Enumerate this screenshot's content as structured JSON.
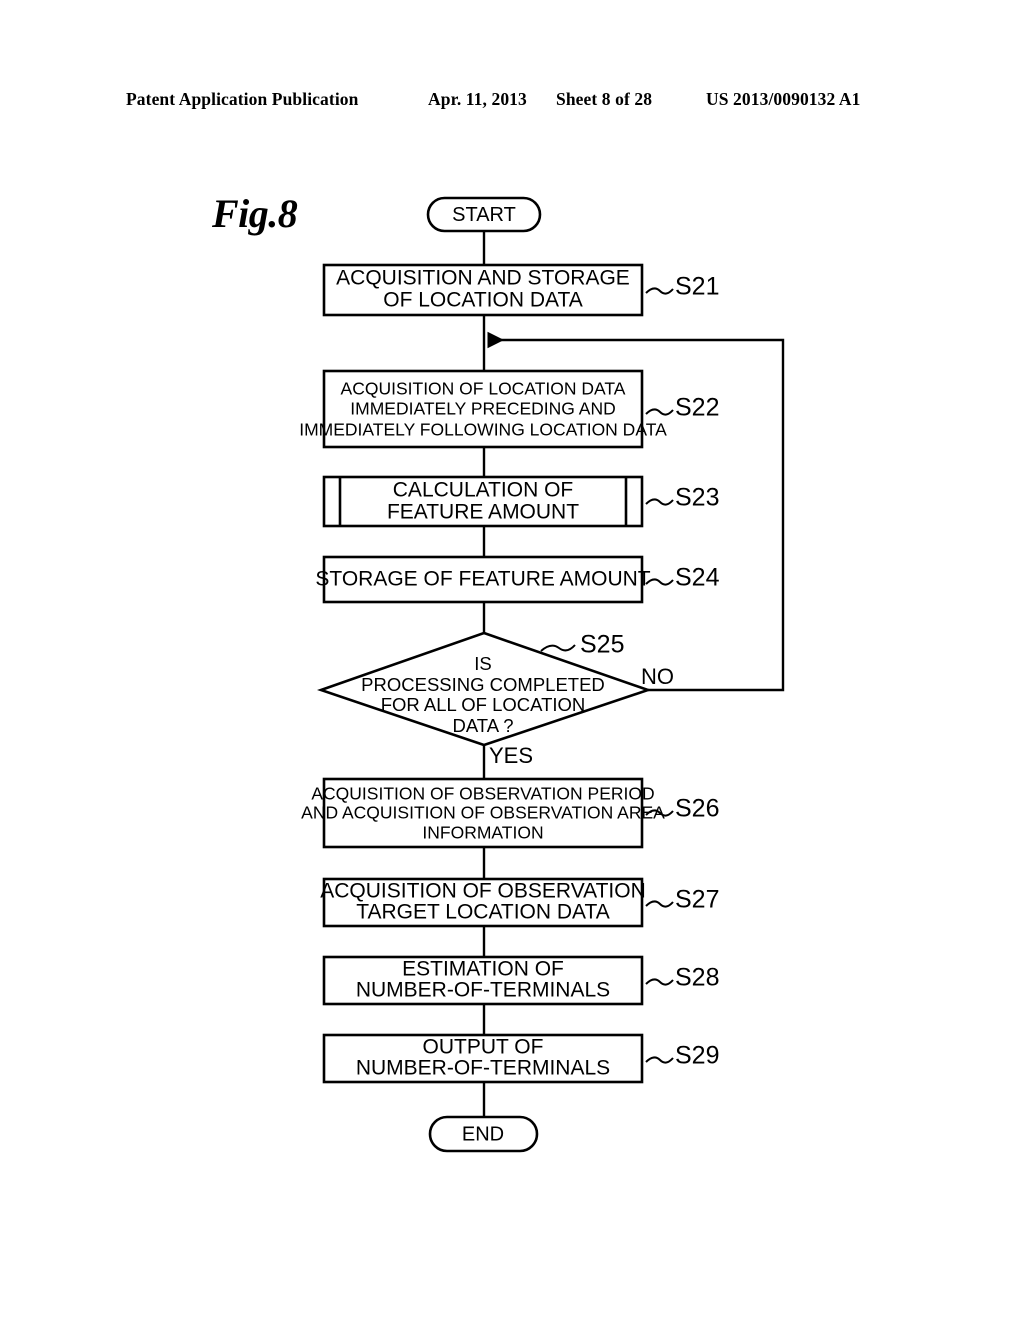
{
  "header": {
    "publication": "Patent Application Publication",
    "date": "Apr. 11, 2013",
    "sheet": "Sheet 8 of 28",
    "publication_number": "US 2013/0090132 A1"
  },
  "figure": {
    "label": "Fig.8"
  },
  "flowchart": {
    "nodes": [
      {
        "id": "start",
        "shape": "terminator",
        "lines": [
          "START"
        ],
        "step": null
      },
      {
        "id": "s21",
        "shape": "process",
        "lines": [
          "ACQUISITION AND STORAGE",
          "OF LOCATION DATA"
        ],
        "step": "S21"
      },
      {
        "id": "s22",
        "shape": "process",
        "lines": [
          "ACQUISITION OF LOCATION DATA",
          "IMMEDIATELY PRECEDING AND",
          "IMMEDIATELY FOLLOWING LOCATION DATA"
        ],
        "step": "S22"
      },
      {
        "id": "s23",
        "shape": "predefined-process",
        "lines": [
          "CALCULATION OF",
          "FEATURE AMOUNT"
        ],
        "step": "S23"
      },
      {
        "id": "s24",
        "shape": "process",
        "lines": [
          "STORAGE OF FEATURE AMOUNT"
        ],
        "step": "S24"
      },
      {
        "id": "s25",
        "shape": "decision",
        "lines": [
          "IS",
          "PROCESSING COMPLETED",
          "FOR ALL OF LOCATION",
          "DATA ?"
        ],
        "step": "S25"
      },
      {
        "id": "s26",
        "shape": "process",
        "lines": [
          "ACQUISITION OF OBSERVATION PERIOD",
          "AND ACQUISITION OF OBSERVATION AREA",
          "INFORMATION"
        ],
        "step": "S26"
      },
      {
        "id": "s27",
        "shape": "process",
        "lines": [
          "ACQUISITION OF OBSERVATION",
          "TARGET LOCATION DATA"
        ],
        "step": "S27"
      },
      {
        "id": "s28",
        "shape": "process",
        "lines": [
          "ESTIMATION OF",
          "NUMBER-OF-TERMINALS"
        ],
        "step": "S28"
      },
      {
        "id": "s29",
        "shape": "process",
        "lines": [
          "OUTPUT OF",
          "NUMBER-OF-TERMINALS"
        ],
        "step": "S29"
      },
      {
        "id": "end",
        "shape": "terminator",
        "lines": [
          "END"
        ],
        "step": null
      }
    ],
    "branch_labels": {
      "no": "NO",
      "yes": "YES"
    },
    "colors": {
      "stroke": "#000000",
      "fill": "#ffffff"
    }
  }
}
